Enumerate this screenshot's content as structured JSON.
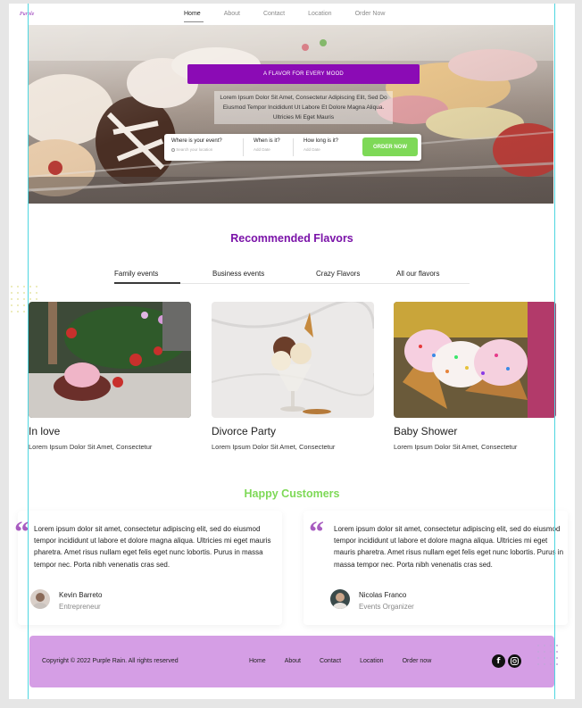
{
  "nav": {
    "logo": "Purple",
    "links": [
      "Home",
      "About",
      "Contact",
      "Location",
      "Order Now"
    ],
    "active": "Home"
  },
  "hero": {
    "title": "A FLAVOR FOR EVERY MOOD",
    "subtitle": "Lorem Ipsum Dolor Sit Amet, Consectetur Adipiscing Elit, Sed Do Eiusmod Tempor Incididunt Ut Labore Et Dolore Magna Aliqua. Ultricies Mi Eget Mauris",
    "booking": {
      "where_label": "Where is your event?",
      "where_placeholder": "Search your location",
      "when_label": "When is it?",
      "when_placeholder": "Add Date",
      "length_label": "How long is it?",
      "length_placeholder": "Add Date",
      "button": "ORDER NOW"
    }
  },
  "recommended": {
    "title": "Recommended Flavors",
    "tabs": [
      "Family events",
      "Business events",
      "Crazy Flavors",
      "All our flavors"
    ],
    "active_tab": "Family events",
    "cards": [
      {
        "title": "In love",
        "desc": "Lorem Ipsum Dolor Sit Amet, Consectetur"
      },
      {
        "title": "Divorce Party",
        "desc": "Lorem Ipsum Dolor Sit Amet, Consectetur"
      },
      {
        "title": "Baby Shower",
        "desc": "Lorem Ipsum Dolor Sit Amet, Consectetur"
      }
    ]
  },
  "customers": {
    "title": "Happy Customers",
    "items": [
      {
        "quote": "Lorem ipsum dolor sit amet, consectetur adipiscing elit, sed do eiusmod tempor incididunt ut labore et dolore magna aliqua. Ultricies mi eget mauris pharetra. Amet risus nullam eget felis eget nunc lobortis. Purus in massa tempor nec. Porta nibh venenatis cras sed.",
        "name": "Kevin Barreto",
        "role": "Entrepreneur"
      },
      {
        "quote": "Lorem ipsum dolor sit amet, consectetur adipiscing elit, sed do eiusmod tempor incididunt ut labore et dolore magna aliqua. Ultricies mi eget mauris pharetra. Amet risus nullam eget felis eget nunc lobortis. Purus in massa tempor nec. Porta nibh venenatis cras sed.",
        "name": "Nicolas Franco",
        "role": "Events Organizer"
      }
    ]
  },
  "footer": {
    "copyright": "Copyright © 2022 Purple Rain. All rights reserved",
    "links": [
      "Home",
      "About",
      "Contact",
      "Location",
      "Order now"
    ],
    "social_icons": [
      "facebook-icon",
      "instagram-icon"
    ]
  },
  "colors": {
    "purple": "#8b0bb5",
    "section_title_purple": "#7a12a8",
    "green": "#7ed957",
    "footer_bg": "#d59ee5",
    "guide": "#4ed6e0"
  }
}
